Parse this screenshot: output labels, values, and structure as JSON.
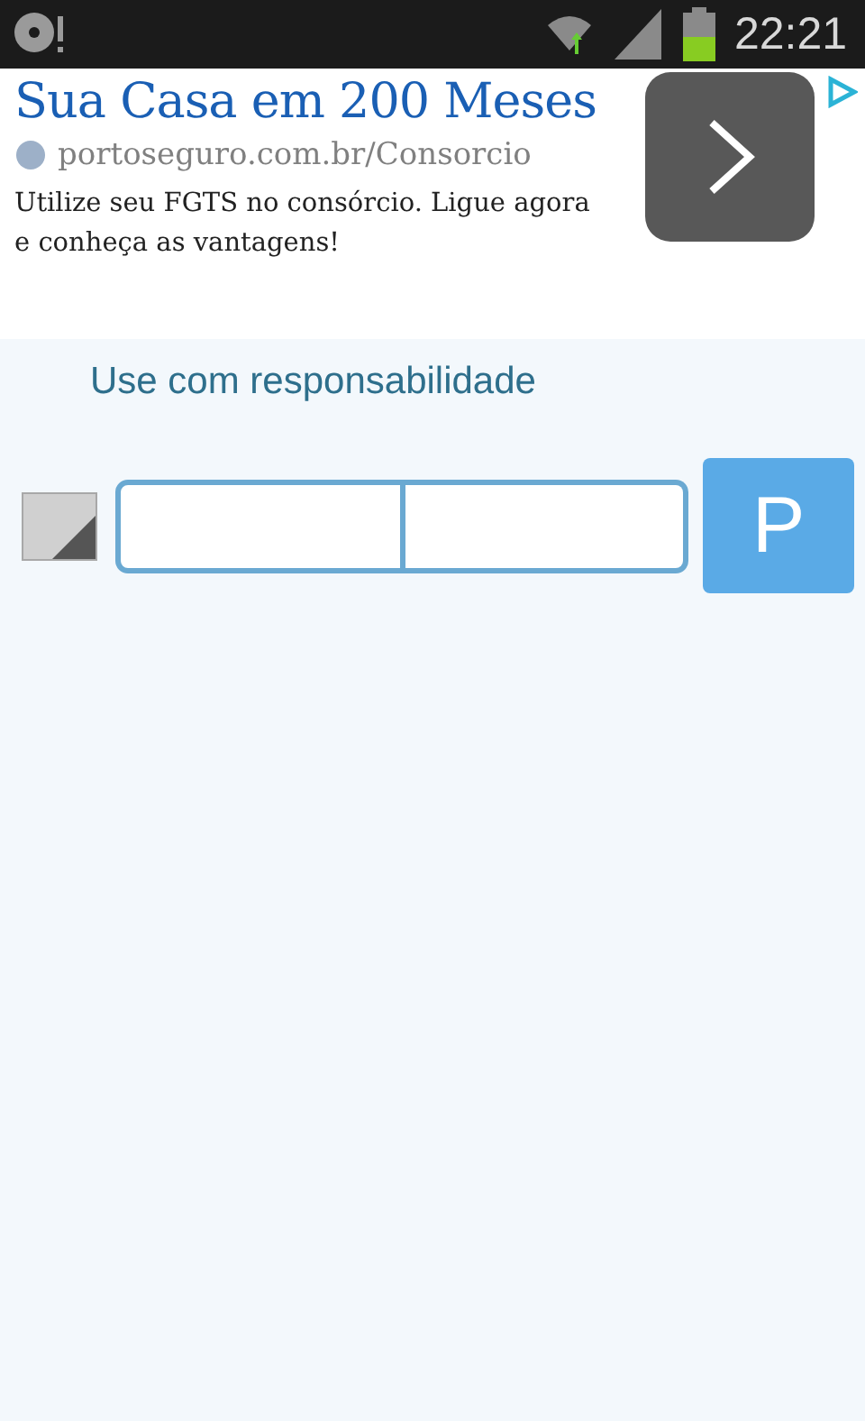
{
  "status_bar": {
    "time": "22:21"
  },
  "ad": {
    "title": "Sua Casa em 200 Meses",
    "url": "portoseguro.com.br/Consorcio",
    "text": "Utilize seu FGTS no consórcio. Ligue agora e conheça as vantagens!"
  },
  "notice": "Use com responsabilidade",
  "form": {
    "fields": [
      {
        "kind": "text"
      },
      {
        "kind": "text"
      }
    ],
    "button": "P"
  }
}
